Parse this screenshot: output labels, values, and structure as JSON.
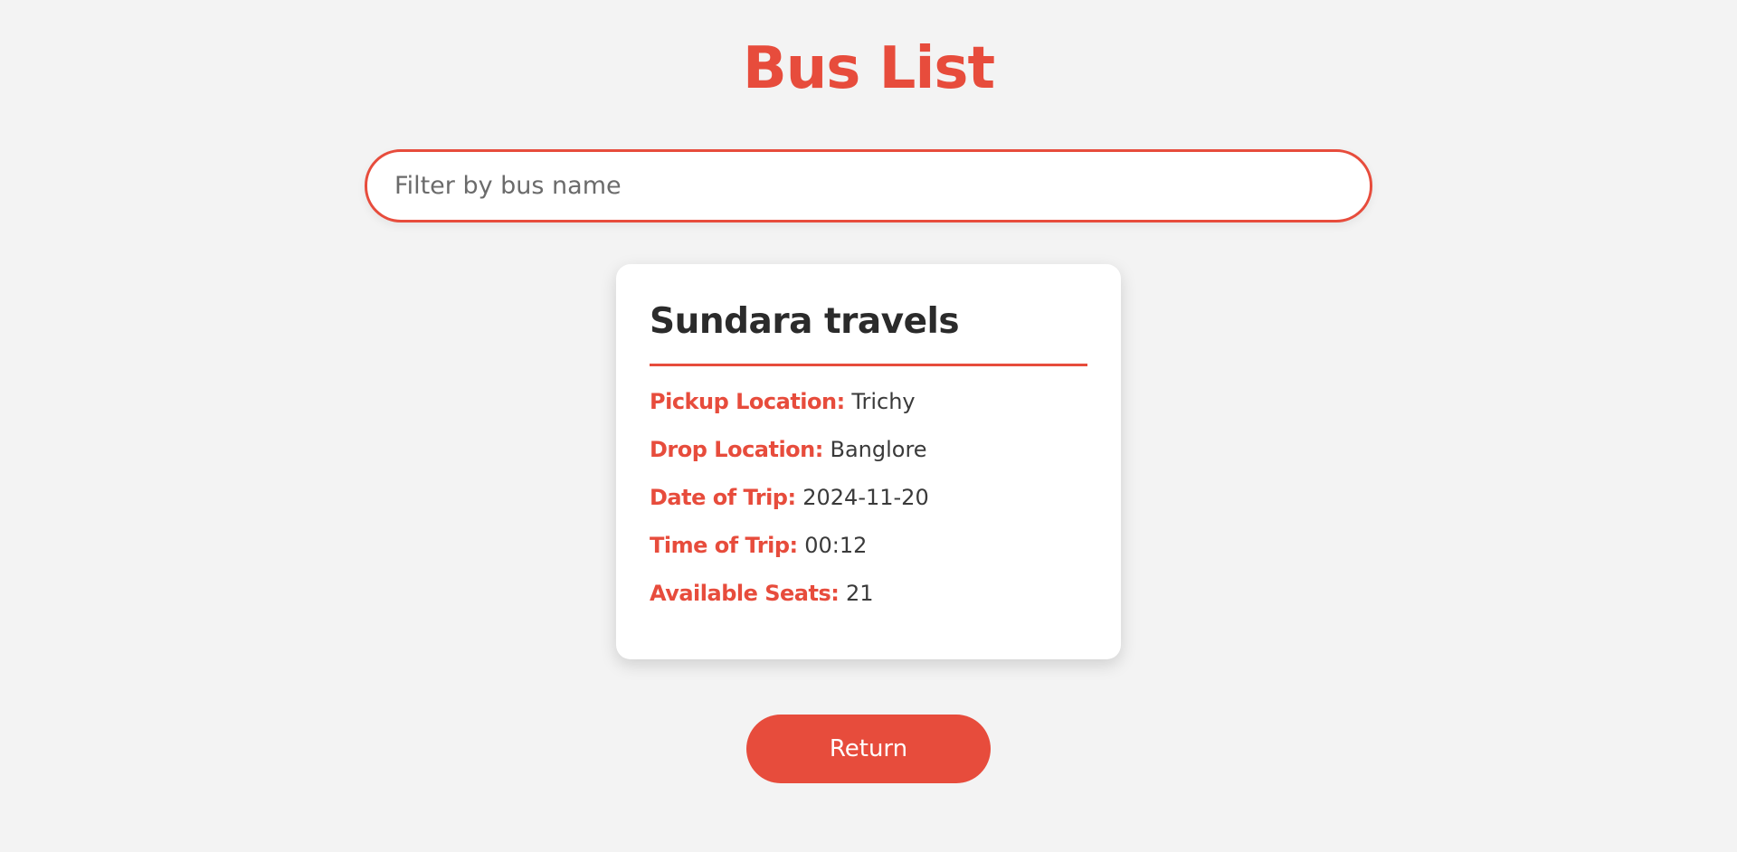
{
  "page": {
    "title": "Bus List"
  },
  "search": {
    "placeholder": "Filter by bus name",
    "value": ""
  },
  "buses": [
    {
      "name": "Sundara travels",
      "details": [
        {
          "label": "Pickup Location:",
          "value": "Trichy"
        },
        {
          "label": "Drop Location:",
          "value": "Banglore"
        },
        {
          "label": "Date of Trip:",
          "value": "2024-11-20"
        },
        {
          "label": "Time of Trip:",
          "value": "00:12"
        },
        {
          "label": "Available Seats:",
          "value": "21"
        }
      ]
    }
  ],
  "actions": {
    "return_label": "Return"
  },
  "colors": {
    "accent": "#e74c3c",
    "background": "#f3f3f3",
    "card": "#ffffff",
    "text": "#2b2b2b"
  }
}
